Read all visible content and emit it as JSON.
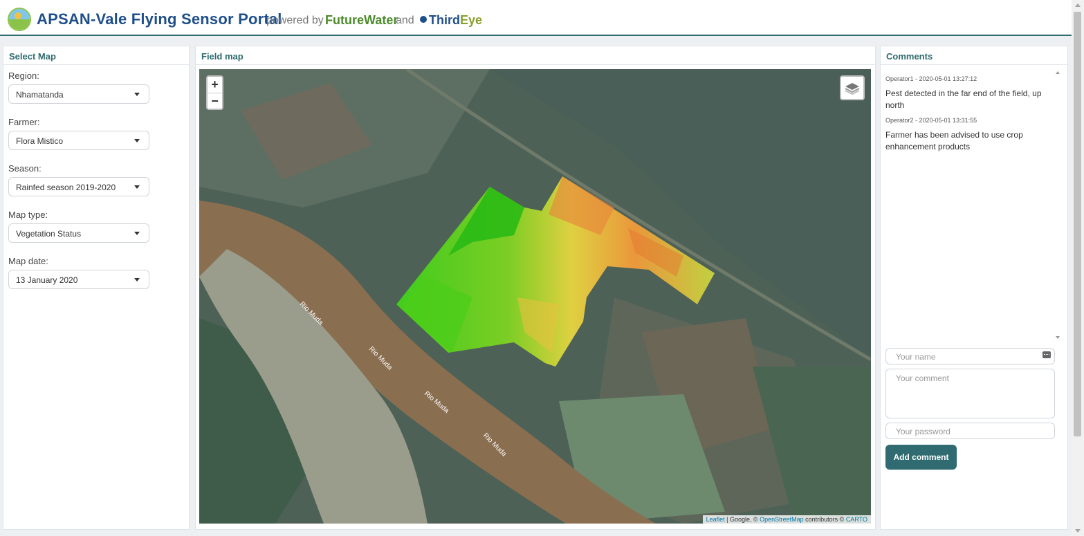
{
  "header": {
    "title": "APSAN-Vale Flying Sensor Portal",
    "powered_by": "powered by",
    "brand1": "FutureWater",
    "and": "and",
    "brand2_a": "Third",
    "brand2_b": "Eye",
    "colors": {
      "title": "#1f4f8a",
      "accent": "#2f6b70",
      "futurewater": "#4c8b2b"
    }
  },
  "select_map": {
    "title": "Select Map",
    "fields": [
      {
        "label": "Region:",
        "value": "Nhamatanda"
      },
      {
        "label": "Farmer:",
        "value": "Flora Mistico"
      },
      {
        "label": "Season:",
        "value": "Rainfed season 2019-2020"
      },
      {
        "label": "Map type:",
        "value": "Vegetation Status"
      },
      {
        "label": "Map date:",
        "value": "13 January 2020"
      }
    ]
  },
  "field_map": {
    "title": "Field map",
    "zoom_in": "+",
    "zoom_out": "−",
    "layers_icon": "layers-icon",
    "river_labels": [
      "Rio Muda",
      "Rio Muda",
      "Rio Muda",
      "Rio Muda"
    ],
    "attribution": {
      "leaflet": "Leaflet",
      "mid": " | Google, © ",
      "osm": "OpenStreetMap",
      "mid2": " contributors © ",
      "carto": "CARTO"
    }
  },
  "comments": {
    "title": "Comments",
    "items": [
      {
        "meta": "Operator1 - 2020-05-01 13:27:12",
        "text": "Pest detected in the far end of the field, up north"
      },
      {
        "meta": "Operator2 - 2020-05-01 13:31:55",
        "text": "Farmer has been advised to use crop enhancement products"
      }
    ],
    "name_placeholder": "Your name",
    "comment_placeholder": "Your comment",
    "password_placeholder": "Your password",
    "add_button": "Add comment"
  }
}
